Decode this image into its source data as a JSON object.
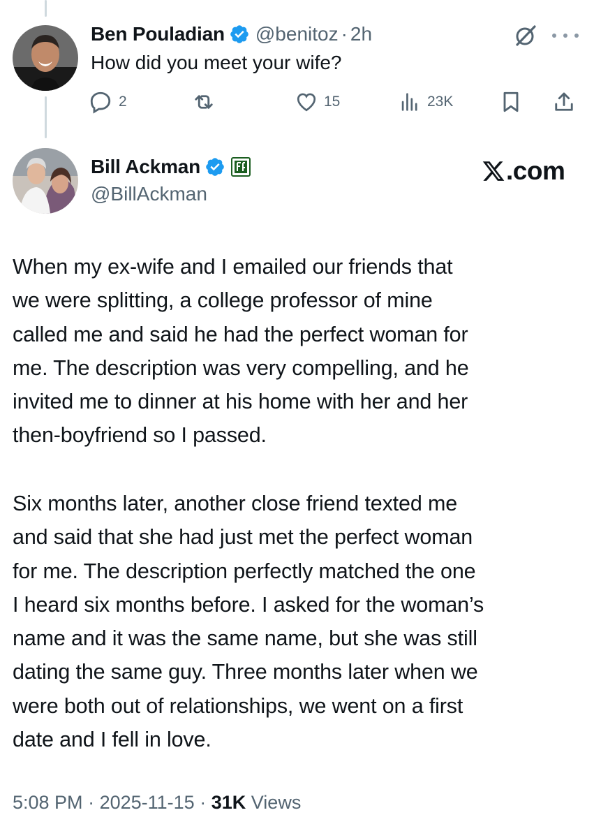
{
  "reply": {
    "name": "Ben Pouladian",
    "handle": "@benitoz",
    "separator": "·",
    "time": "2h",
    "text": "How did you meet your wife?",
    "counts": {
      "replies": "2",
      "likes": "15",
      "views": "23K"
    }
  },
  "tweet": {
    "name": "Bill Ackman",
    "handle": "@BillAckman",
    "paragraph1": [
      "When my ex-wife and I emailed our friends that",
      "we were splitting, a college professor of mine",
      "called me and said he had the perfect woman for",
      "me. The description was very compelling, and he",
      "invited me to dinner at his home with her and her",
      "then-boyfriend so I passed."
    ],
    "paragraph2": [
      "Six months later, another close friend texted me",
      "and said that she had just met the perfect woman",
      "for me. The description perfectly matched the one",
      "I heard six months before. I asked for the woman’s",
      "name and it was the same name, but she was still",
      "dating the same guy. Three months later when we",
      "were both out of relationships, we went on a first",
      "date and I fell in love."
    ],
    "meta": {
      "time": "5:08 PM",
      "separator": "·",
      "date": "2025-11-15",
      "views_count": "31K",
      "views_label": "Views"
    }
  },
  "brand": {
    "suffix": ".com"
  },
  "icons": {
    "verified": "verified-badge-icon",
    "affiliation": "affiliation-badge-icon",
    "grok": "grok-icon",
    "more": "more-icon",
    "reply": "reply-icon",
    "repost": "repost-icon",
    "like": "heart-icon",
    "views": "views-icon",
    "bookmark": "bookmark-icon",
    "share": "share-icon"
  },
  "colors": {
    "verified": "#1d9bf0",
    "text": "#0f1419",
    "secondary": "#536471",
    "thread_line": "#cfd9de",
    "affiliation_bg": "#1b5e20"
  }
}
